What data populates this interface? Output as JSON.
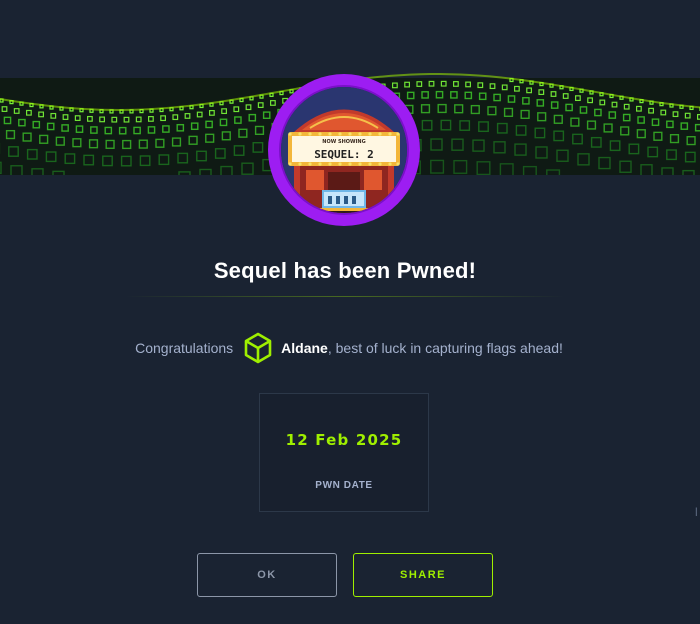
{
  "machine": {
    "name": "Sequel",
    "marquee_top": "NOW SHOWING",
    "marquee_main": "SEQUEL: 2",
    "avatar_icon": "movie-theater-icon",
    "ring_color": "#9d1df2"
  },
  "headline": "Sequel has been Pwned!",
  "message": {
    "prefix": "Congratulations",
    "user_icon": "cube-icon",
    "username": "Aldane",
    "suffix": ", best of luck in capturing flags ahead!"
  },
  "pwn": {
    "date": "12 Feb 2025",
    "label": "PWN DATE"
  },
  "buttons": {
    "ok": "OK",
    "share": "SHARE"
  },
  "edge_text": "l",
  "colors": {
    "background": "#1a2332",
    "accent_green": "#9fef00",
    "muted_text": "#a4b1cd"
  }
}
